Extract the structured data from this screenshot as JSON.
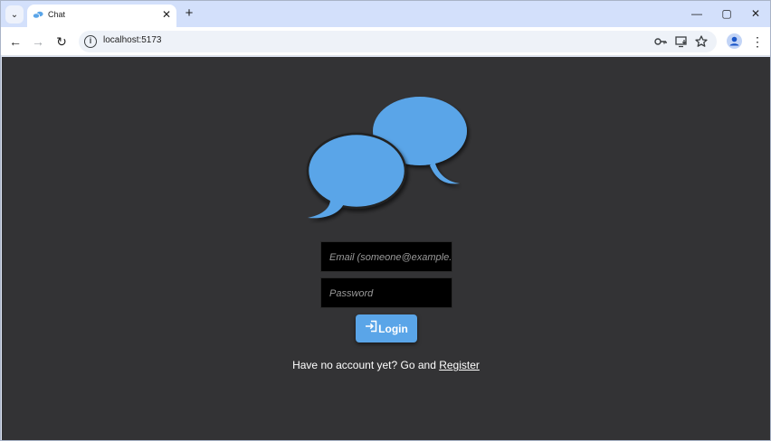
{
  "browser": {
    "tab": {
      "title": "Chat",
      "close_glyph": "✕"
    },
    "tab_search_glyph": "⌄",
    "new_tab_glyph": "+",
    "window_controls": {
      "minimize": "—",
      "maximize": "▢",
      "close": "✕"
    },
    "nav": {
      "back": "←",
      "forward": "→",
      "reload": "↻"
    },
    "address": {
      "url": "localhost:5173",
      "site_info_glyph": "i"
    },
    "icons": [
      "key-icon",
      "install-app-icon",
      "bookmark-star-icon",
      "profile-icon",
      "menu-icon"
    ],
    "menu_glyph": "⋮"
  },
  "page": {
    "logo": {
      "icon": "chat-bubbles-icon",
      "color": "#5aa5e8"
    },
    "form": {
      "email_placeholder": "Email (someone@example.com)",
      "password_placeholder": "Password",
      "login_label": "Login",
      "login_icon": "login-icon"
    },
    "footer": {
      "prefix": "Have no account yet? Go and ",
      "register_link": "Register"
    },
    "colors": {
      "background": "#333335",
      "accent": "#5aa5e8",
      "input_bg": "#000000"
    }
  }
}
